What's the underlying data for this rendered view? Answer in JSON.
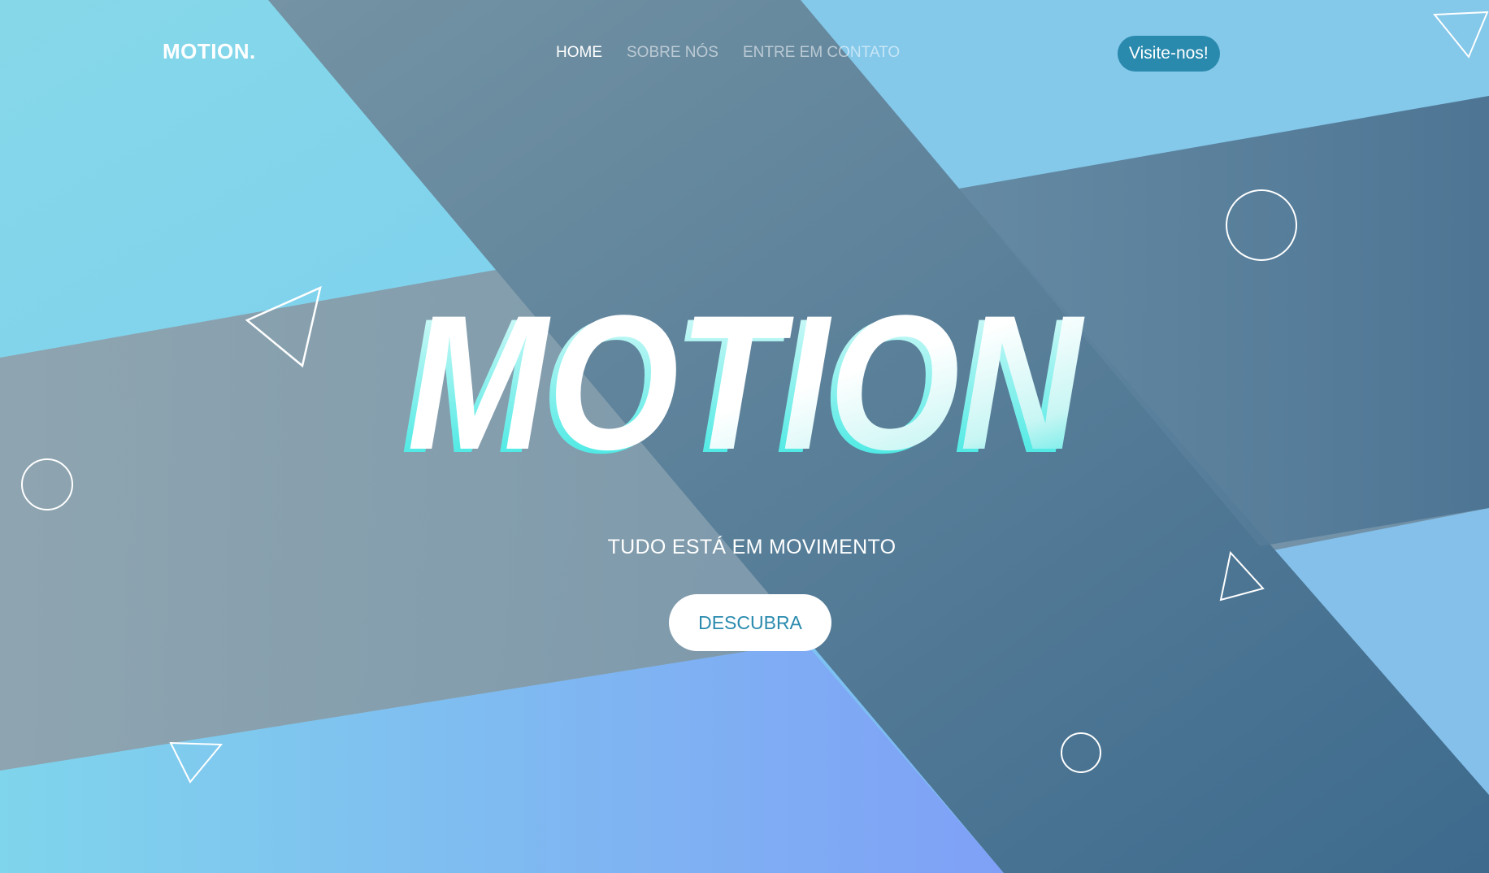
{
  "brand": {
    "logo": "MOTION."
  },
  "nav": {
    "items": [
      {
        "label": "HOME",
        "active": true
      },
      {
        "label": "SOBRE NÓS",
        "active": false
      },
      {
        "label": "ENTRE EM CONTATO",
        "active": false
      }
    ],
    "cta_label": "Visite-nos!"
  },
  "hero": {
    "title": "MOTION",
    "tagline": "TUDO ESTÁ EM MOVIMENTO",
    "button_label": "DESCUBRA"
  },
  "colors": {
    "accent": "#2a8aae",
    "slate_dark": "#3f6a8c",
    "slate_light": "#8fa3b0",
    "sky": "#7ed3ea",
    "periwinkle": "#7fa6f4",
    "cyan_glow": "#2ee6e0"
  },
  "decorations": [
    {
      "shape": "triangle-outline-icon"
    },
    {
      "shape": "circle-outline-icon"
    },
    {
      "shape": "triangle-outline-icon"
    },
    {
      "shape": "triangle-outline-icon"
    },
    {
      "shape": "circle-outline-icon"
    },
    {
      "shape": "triangle-outline-icon"
    },
    {
      "shape": "circle-outline-icon"
    }
  ]
}
